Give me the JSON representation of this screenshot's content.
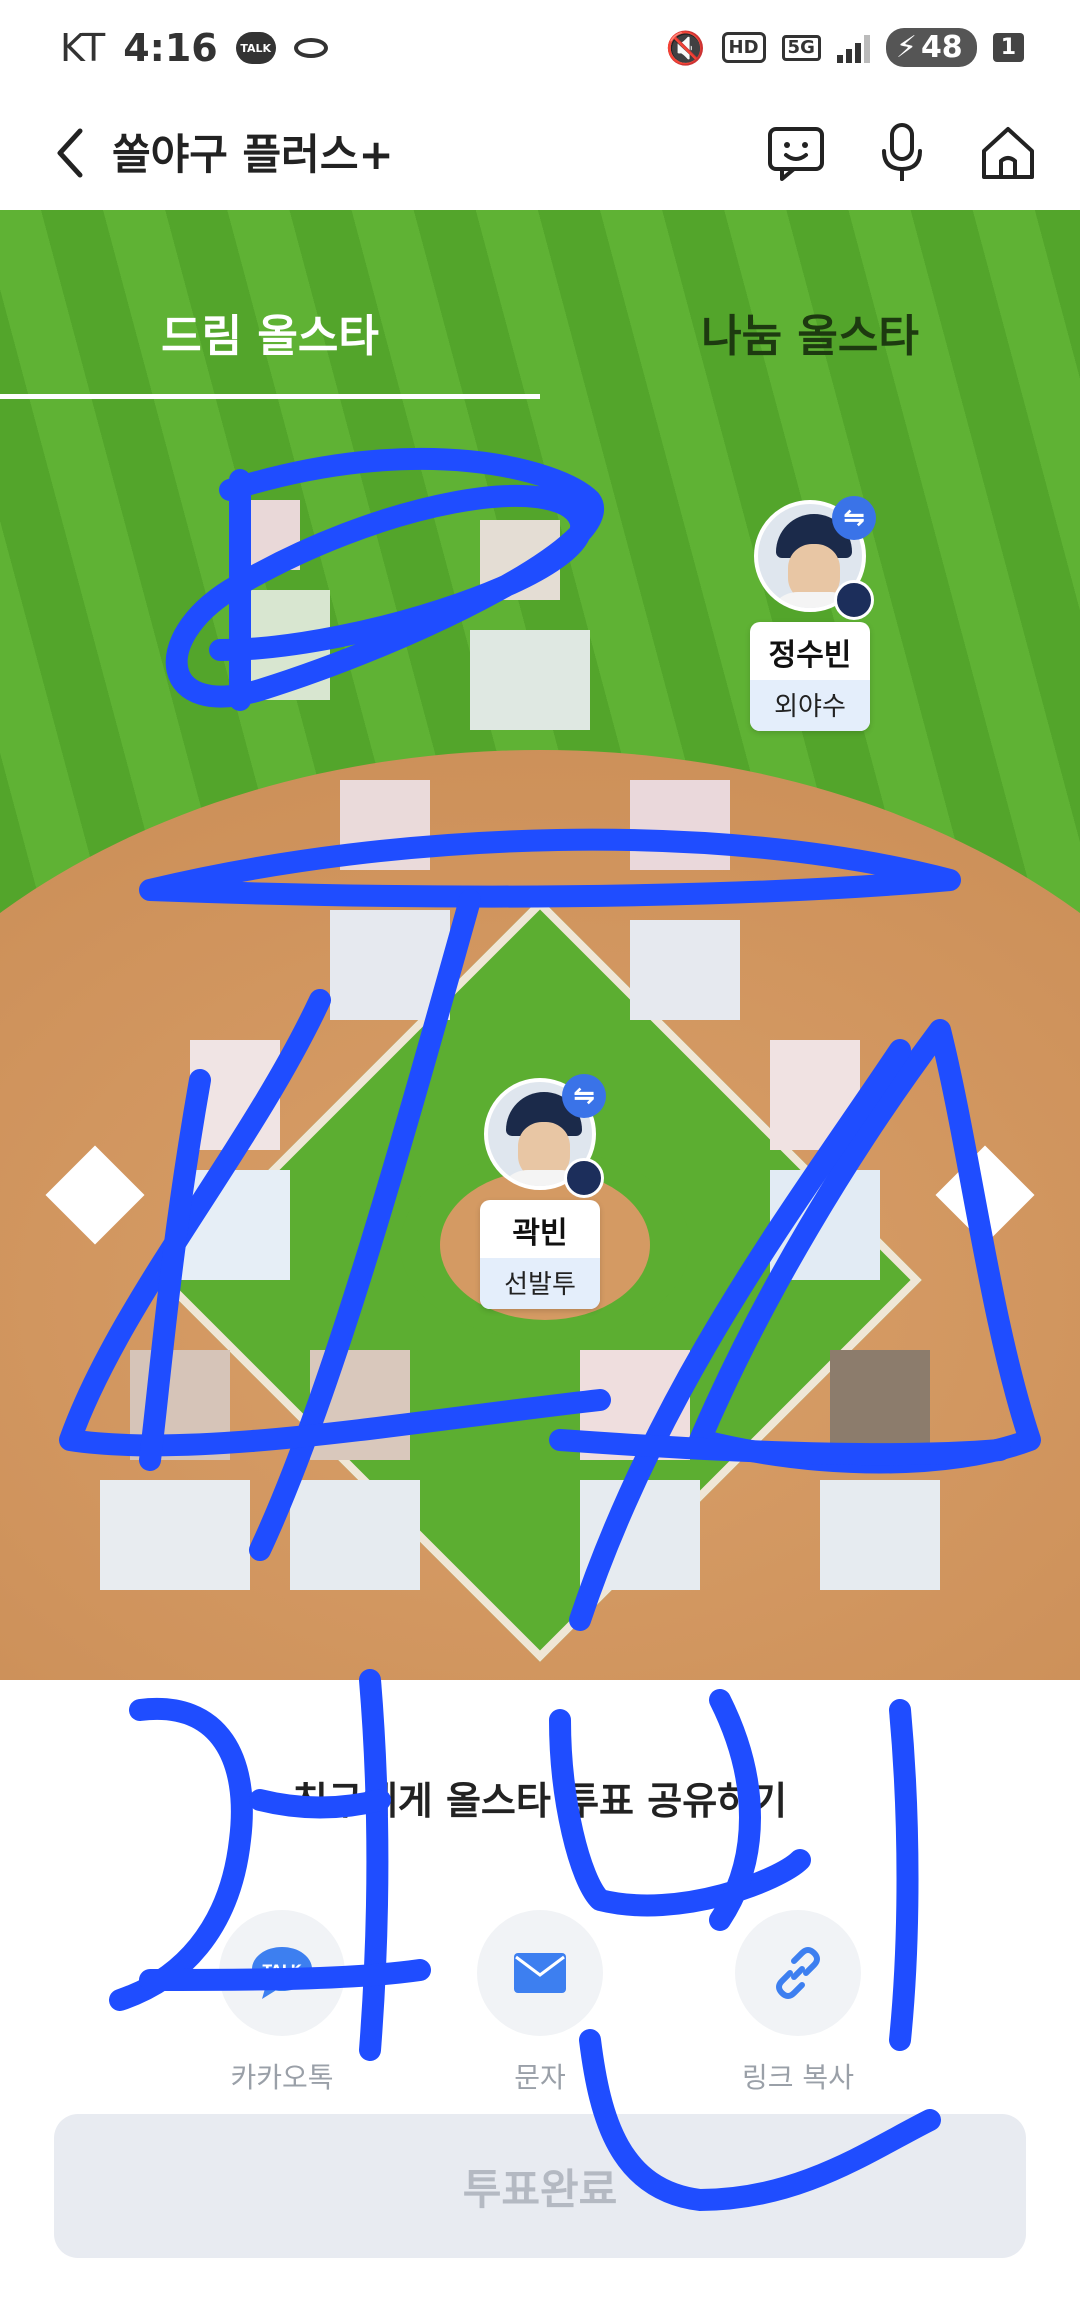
{
  "status_bar": {
    "carrier": "KT",
    "time": "4:16",
    "talk_badge": "TALK",
    "hd": "HD",
    "network": "5G",
    "battery": "48",
    "sim": "1"
  },
  "app_bar": {
    "title": "쏠야구 플러스+",
    "icons": [
      "chat-face-icon",
      "mic-icon",
      "home-icon"
    ]
  },
  "tabs": [
    {
      "label": "드림 올스타",
      "active": true
    },
    {
      "label": "나눔 올스타",
      "active": false
    }
  ],
  "players": [
    {
      "name": "정수빈",
      "position": "외야수"
    },
    {
      "name": "곽빈",
      "position": "선발투"
    }
  ],
  "share": {
    "title": "친구에게 올스타 투표 공유하기",
    "options": [
      {
        "label": "카카오톡",
        "icon": "kakaotalk-icon"
      },
      {
        "label": "문자",
        "icon": "message-icon"
      },
      {
        "label": "링크 복사",
        "icon": "link-icon"
      }
    ],
    "talk_icon_text": "TALK"
  },
  "vote_button": "투표완료",
  "colors": {
    "field_green": "#5fb234",
    "dirt": "#cf935c",
    "scribble_blue": "#1f4dff",
    "swap_badge": "#3a73e8",
    "position_bg": "#e4eefb"
  }
}
